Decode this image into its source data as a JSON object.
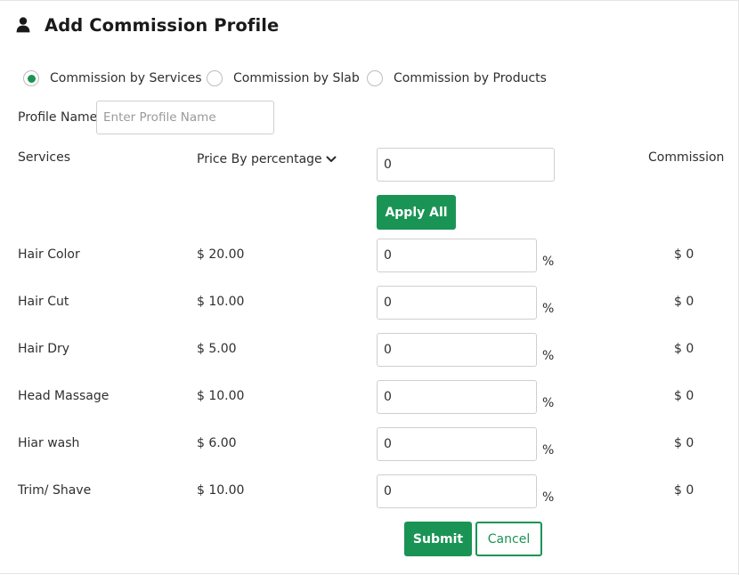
{
  "header": {
    "title": "Add Commission Profile",
    "icon": "user-icon"
  },
  "commission_type": {
    "selected": 0,
    "options": [
      {
        "label": "Commission by Services"
      },
      {
        "label": "Commission by Slab"
      },
      {
        "label": "Commission by Products"
      }
    ]
  },
  "profile": {
    "label": "Profile Name",
    "placeholder": "Enter Profile Name",
    "value": ""
  },
  "table": {
    "headers": {
      "services": "Services",
      "price_mode": "Price By percentage",
      "commission": "Commission"
    },
    "apply_all_value": "0",
    "apply_all_label": "Apply All",
    "percent_symbol": "%",
    "rows": [
      {
        "service": "Hair Color",
        "price": "$ 20.00",
        "value": "0",
        "commission": "$ 0"
      },
      {
        "service": "Hair Cut",
        "price": "$ 10.00",
        "value": "0",
        "commission": "$ 0"
      },
      {
        "service": "Hair Dry",
        "price": "$ 5.00",
        "value": "0",
        "commission": "$ 0"
      },
      {
        "service": "Head Massage",
        "price": "$ 10.00",
        "value": "0",
        "commission": "$ 0"
      },
      {
        "service": "Hiar wash",
        "price": "$ 6.00",
        "value": "0",
        "commission": "$ 0"
      },
      {
        "service": "Trim/ Shave",
        "price": "$ 10.00",
        "value": "0",
        "commission": "$ 0"
      }
    ]
  },
  "actions": {
    "submit": "Submit",
    "cancel": "Cancel"
  },
  "colors": {
    "accent": "#1a9454",
    "border": "#cfcfcf",
    "text": "#2f2f2f"
  }
}
